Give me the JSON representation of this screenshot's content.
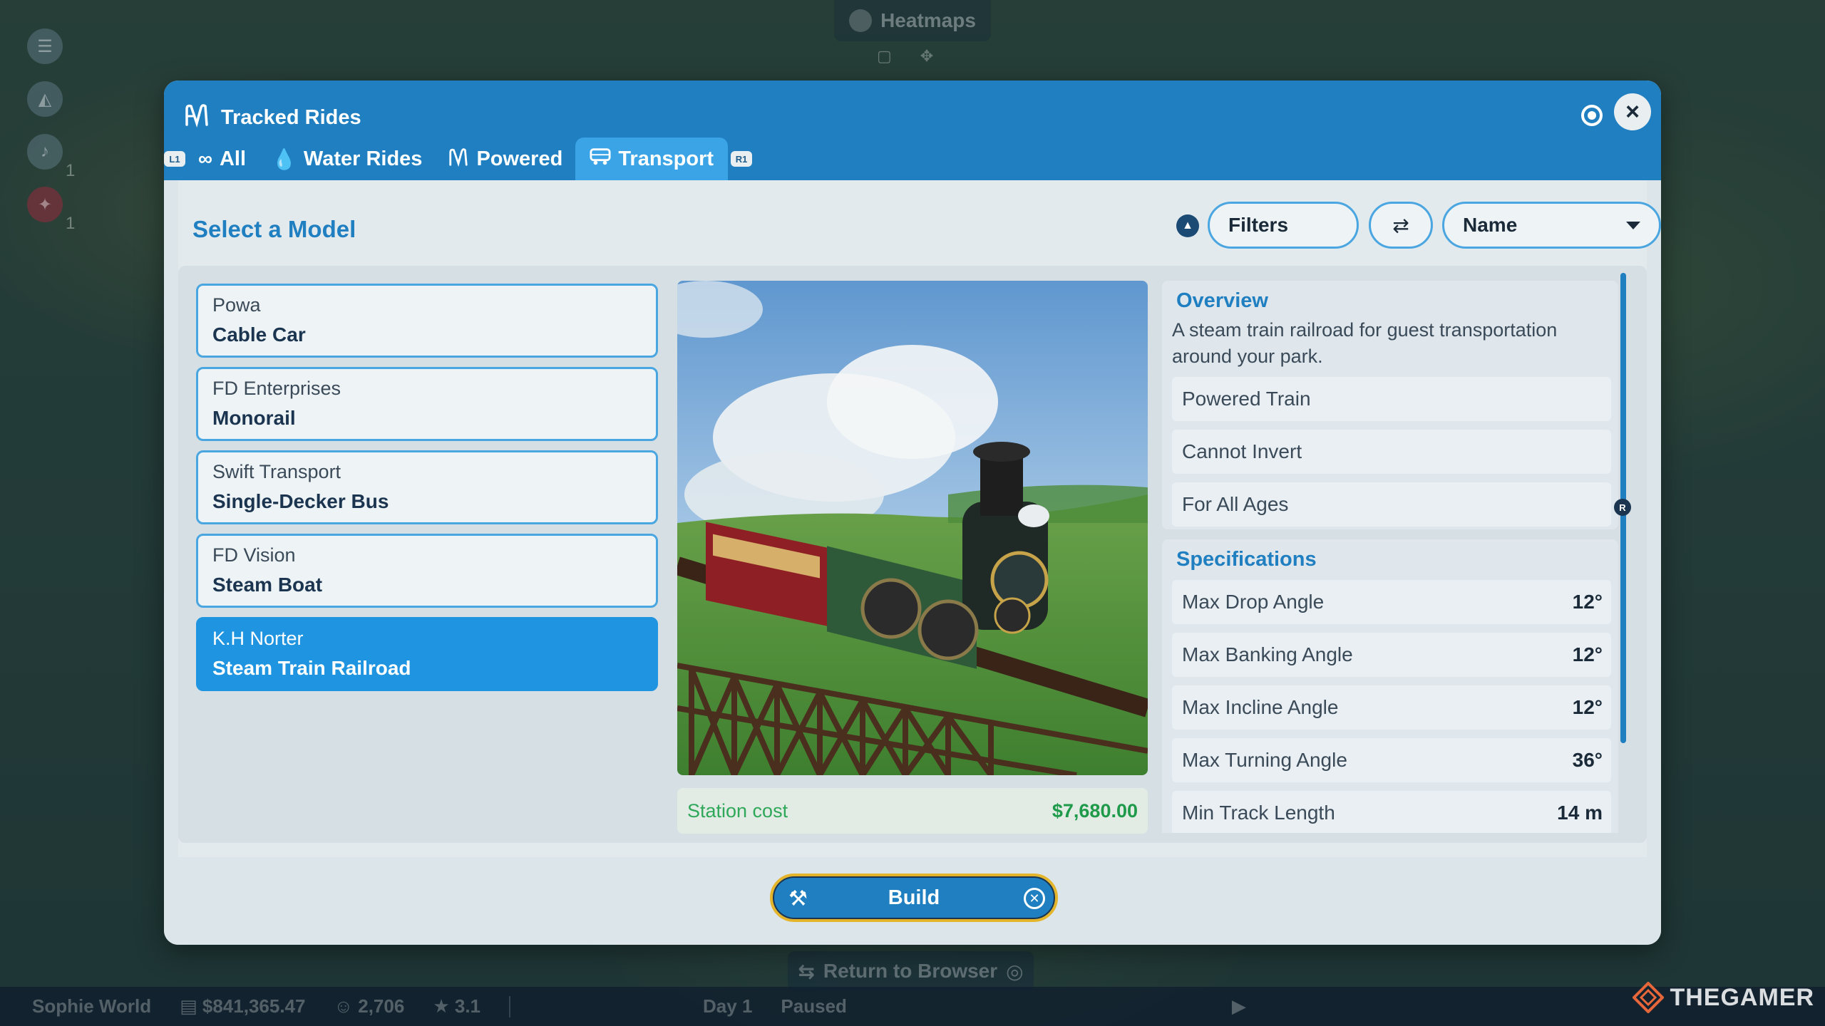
{
  "background": {
    "heatmaps_label": "Heatmaps",
    "return_label": "Return to Browser",
    "bottom_bar": {
      "park_name": "Sophie World",
      "money": "$841,365.47",
      "guests": "2,706",
      "rating": "3.1",
      "day": "Day 1",
      "status": "Paused"
    },
    "hud_counts": [
      "1",
      "1"
    ],
    "watermark": "THEGAMER"
  },
  "dialog": {
    "title": "Tracked Rides",
    "tabs": [
      {
        "label": "All",
        "icon": "infinity-icon"
      },
      {
        "label": "Water Rides",
        "icon": "droplet-icon"
      },
      {
        "label": "Powered",
        "icon": "powered-ride-icon"
      },
      {
        "label": "Transport",
        "icon": "transport-icon"
      }
    ],
    "tab_badges": {
      "left": "L1",
      "right": "R1"
    },
    "select_title": "Select a Model",
    "filters_label": "Filters",
    "sort_label": "Name",
    "models": [
      {
        "manufacturer": "Powa",
        "name": "Cable Car"
      },
      {
        "manufacturer": "FD Enterprises",
        "name": "Monorail"
      },
      {
        "manufacturer": "Swift Transport",
        "name": "Single-Decker Bus"
      },
      {
        "manufacturer": "FD Vision",
        "name": "Steam Boat"
      },
      {
        "manufacturer": "K.H Norter",
        "name": "Steam Train Railroad"
      }
    ],
    "station_cost": {
      "label": "Station cost",
      "value": "$7,680.00"
    },
    "overview": {
      "title": "Overview",
      "text": "A steam train railroad for guest transportation around your park.",
      "tags": [
        "Powered Train",
        "Cannot Invert",
        "For All Ages"
      ]
    },
    "specifications": {
      "title": "Specifications",
      "rows": [
        {
          "label": "Max Drop Angle",
          "value": "12°"
        },
        {
          "label": "Max Banking Angle",
          "value": "12°"
        },
        {
          "label": "Max Incline Angle",
          "value": "12°"
        },
        {
          "label": "Max Turning Angle",
          "value": "36°"
        },
        {
          "label": "Min Track Length",
          "value": "14 m"
        }
      ]
    },
    "scroll_badge": "R",
    "build_label": "Build"
  },
  "colors": {
    "header_blue": "#1f7fc0",
    "active_tab": "#3aa4e6",
    "selected_item": "#1f94e0",
    "cost_green": "#1e9a4a",
    "build_border": "#e4b52a"
  }
}
